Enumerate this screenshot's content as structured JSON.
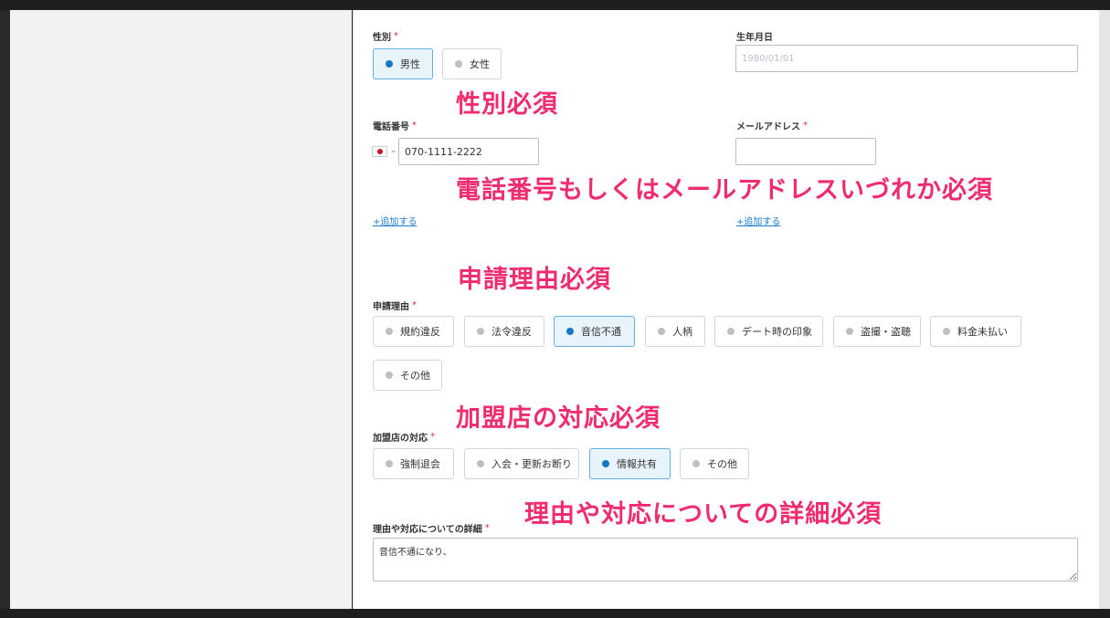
{
  "gender": {
    "label": "性別",
    "required_mark": "*",
    "options": [
      {
        "label": "男性",
        "selected": true
      },
      {
        "label": "女性",
        "selected": false
      }
    ]
  },
  "birthdate": {
    "label": "生年月日",
    "placeholder": "1980/01/01"
  },
  "phone": {
    "label": "電話番号",
    "required_mark": "*",
    "value": "070-1111-2222",
    "add_link": "+追加する"
  },
  "email": {
    "label": "メールアドレス",
    "required_mark": "*",
    "value": "",
    "add_link": "+追加する"
  },
  "reason": {
    "label": "申請理由",
    "required_mark": "*",
    "options": [
      {
        "label": "規約違反",
        "selected": false
      },
      {
        "label": "法令違反",
        "selected": false
      },
      {
        "label": "音信不通",
        "selected": true
      },
      {
        "label": "人柄",
        "selected": false
      },
      {
        "label": "デート時の印象",
        "selected": false
      },
      {
        "label": "盗撮・盗聴",
        "selected": false
      },
      {
        "label": "料金未払い",
        "selected": false
      },
      {
        "label": "その他",
        "selected": false
      }
    ]
  },
  "response": {
    "label": "加盟店の対応",
    "required_mark": "*",
    "options": [
      {
        "label": "強制退会",
        "selected": false
      },
      {
        "label": "入会・更新お断り",
        "selected": false
      },
      {
        "label": "情報共有",
        "selected": true
      },
      {
        "label": "その他",
        "selected": false
      }
    ]
  },
  "detail": {
    "label": "理由や対応についての詳細",
    "required_mark": "*",
    "value": "音信不通になり、"
  },
  "annotations": {
    "gender": "性別必須",
    "contact": "電話番号もしくはメールアドレスいづれか必須",
    "reason": "申請理由必須",
    "response": "加盟店の対応必須",
    "detail": "理由や対応についての詳細必須"
  },
  "colors": {
    "accent": "#1677c6",
    "selected_bg": "#e8f4fc",
    "annotation": "#ef2c6e",
    "required": "#e0245e"
  }
}
